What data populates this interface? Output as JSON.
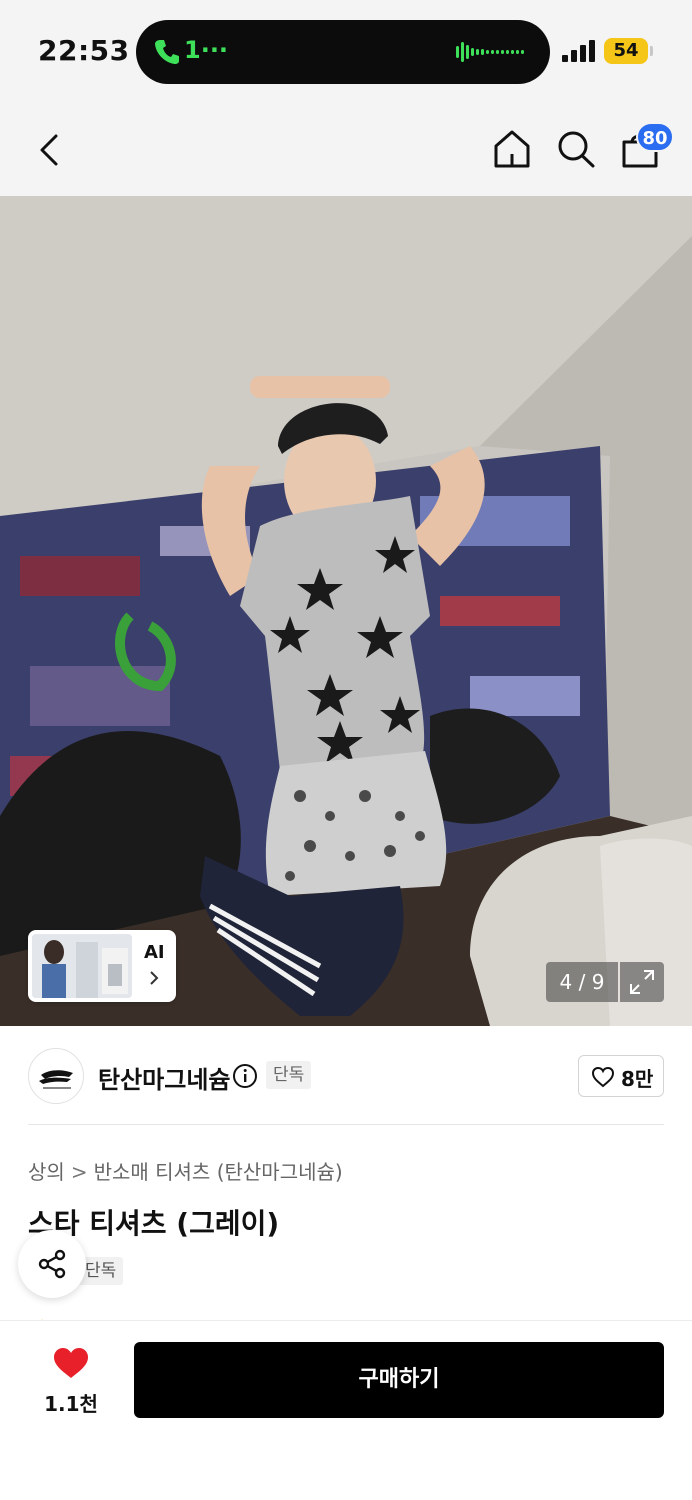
{
  "status_bar": {
    "time": "22:53",
    "call_label": "1···",
    "battery": "54"
  },
  "nav": {
    "back_icon": "chevron-left-icon",
    "home_icon": "home-icon",
    "search_icon": "search-icon",
    "cart_icon": "shopping-bag-icon",
    "cart_badge": "80"
  },
  "gallery": {
    "ai_label": "AI",
    "counter": "4 / 9",
    "expand_icon": "expand-icon"
  },
  "brand": {
    "name": "탄산마그네슘",
    "badge": "단독",
    "like_count": "8만"
  },
  "product": {
    "breadcrumb": [
      "상의",
      "반소매 티셔츠 (탄산마그네슘)"
    ],
    "title": "스타 티셔츠 (그레이)",
    "tag": "단독"
  },
  "bottom_bar": {
    "wish_count": "1.1천",
    "buy_label": "구매하기"
  },
  "colors": {
    "accent_blue": "#2b6df0",
    "heart_red": "#e8202a",
    "buy_button": "#000000",
    "call_green": "#3ee05a",
    "battery_yellow": "#f5c518"
  }
}
